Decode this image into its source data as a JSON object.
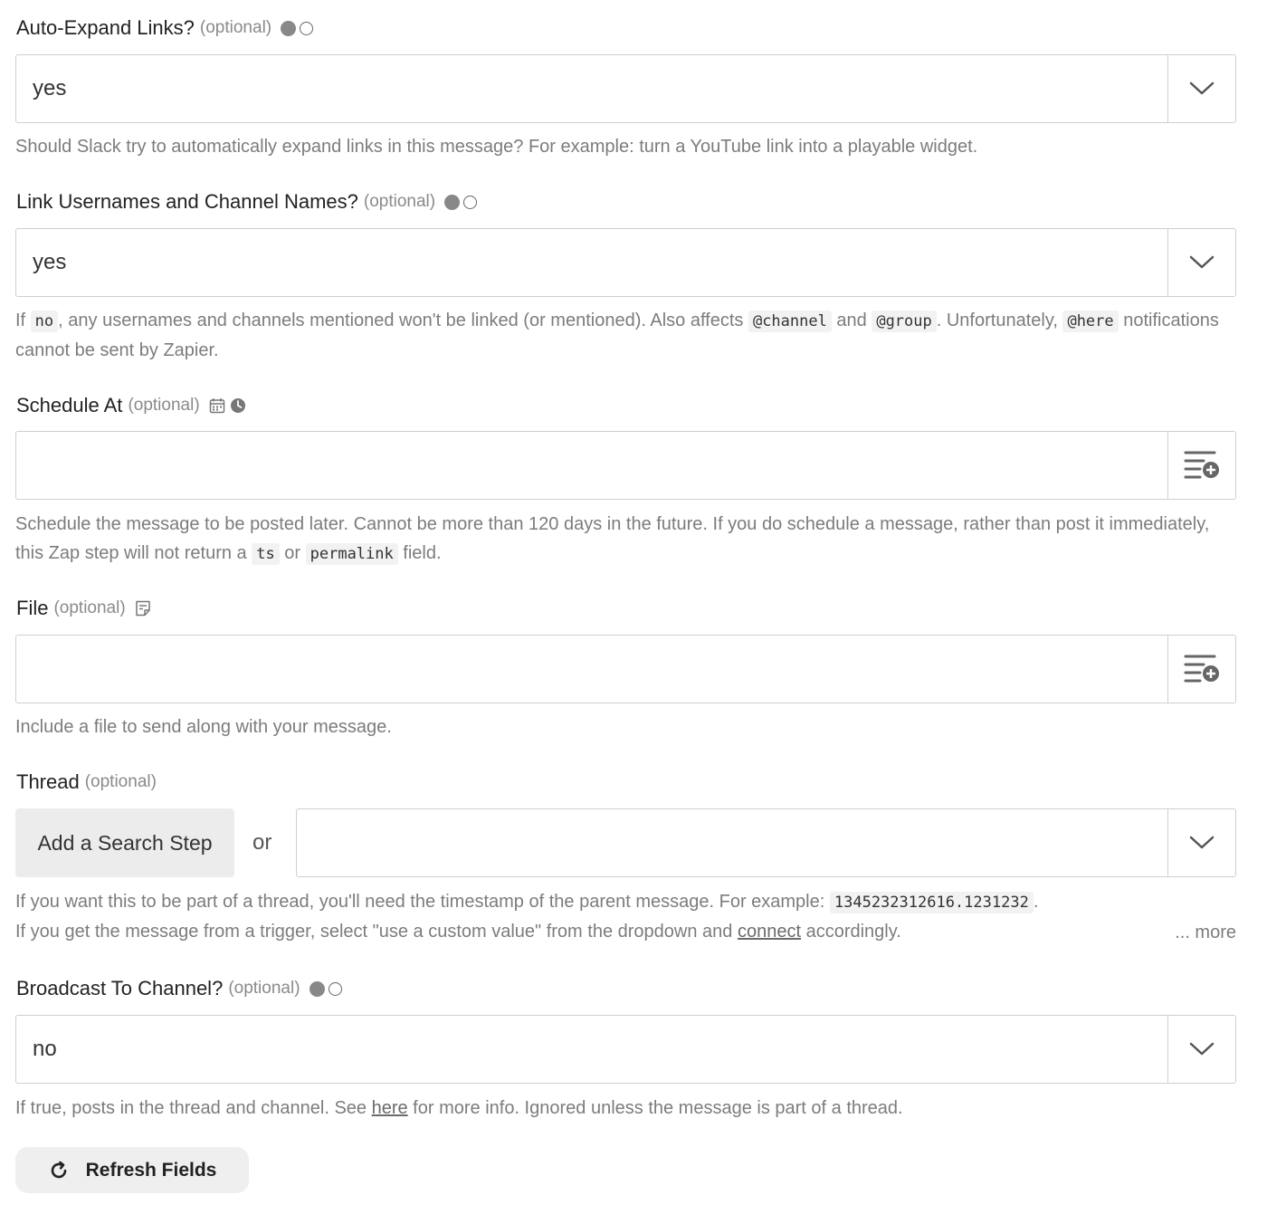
{
  "optional_tag": "(optional)",
  "auto_expand": {
    "label": "Auto-Expand Links?",
    "value": "yes",
    "help": "Should Slack try to automatically expand links in this message? For example: turn a YouTube link into a playable widget."
  },
  "link_names": {
    "label": "Link Usernames and Channel Names?",
    "value": "yes",
    "help_parts": [
      "If ",
      "no",
      ", any usernames and channels mentioned won't be linked (or mentioned). Also affects ",
      "@channel",
      " and ",
      "@group",
      ". Unfortunately, ",
      "@here",
      " notifications cannot be sent by Zapier."
    ]
  },
  "schedule_at": {
    "label": "Schedule At",
    "value": "",
    "help_parts": [
      "Schedule the message to be posted later. Cannot be more than 120 days in the future. If you do schedule a message, rather than post it immediately, this Zap step will not return a ",
      "ts",
      " or ",
      "permalink",
      " field."
    ]
  },
  "file": {
    "label": "File",
    "value": "",
    "help": "Include a file to send along with your message."
  },
  "thread": {
    "label": "Thread",
    "search_button": "Add a Search Step",
    "or": "or",
    "value": "",
    "help_parts": [
      "If you want this to be part of a thread, you'll need the timestamp of the parent message. For example: ",
      "1345232312616.1231232",
      ".",
      "If you get the message from a trigger, select \"use a custom value\" from the dropdown and ",
      "connect",
      " accordingly."
    ],
    "more": "... more"
  },
  "broadcast": {
    "label": "Broadcast To Channel?",
    "value": "no",
    "help_parts": [
      "If true, posts in the thread and channel. See ",
      "here",
      " for more info. Ignored unless the message is part of a thread."
    ]
  },
  "refresh_button": "Refresh Fields"
}
